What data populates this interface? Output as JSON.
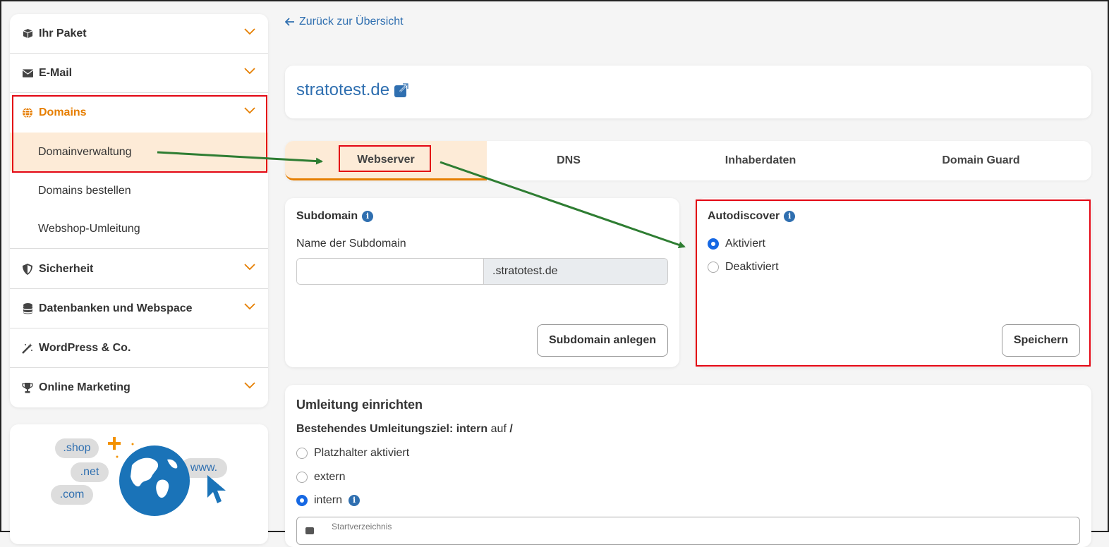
{
  "sidebar": {
    "items": [
      {
        "label": "Ihr Paket",
        "icon": "box-icon"
      },
      {
        "label": "E-Mail",
        "icon": "envelope-icon"
      },
      {
        "label": "Domains",
        "icon": "globe-icon"
      },
      {
        "label": "Sicherheit",
        "icon": "shield-icon"
      },
      {
        "label": "Datenbanken und Webspace",
        "icon": "database-icon"
      },
      {
        "label": "WordPress & Co.",
        "icon": "magic-wand-icon"
      },
      {
        "label": "Online Marketing",
        "icon": "trophy-icon"
      }
    ],
    "sub_items": [
      {
        "label": "Domainverwaltung"
      },
      {
        "label": "Domains bestellen"
      },
      {
        "label": "Webshop-Umleitung"
      }
    ],
    "accent_color": "#e67e00"
  },
  "promo": {
    "shop": ".shop",
    "net": ".net",
    "com": ".com",
    "www": "www."
  },
  "back_link": "Zurück zur Übersicht",
  "domain": "stratotest.de",
  "tabs": [
    {
      "label": "Webserver"
    },
    {
      "label": "DNS"
    },
    {
      "label": "Inhaberdaten"
    },
    {
      "label": "Domain Guard"
    }
  ],
  "subdomain": {
    "title": "Subdomain",
    "field_label": "Name der Subdomain",
    "value": "",
    "suffix": ".stratotest.de",
    "button": "Subdomain anlegen"
  },
  "autodiscover": {
    "title": "Autodiscover",
    "options": [
      {
        "label": "Aktiviert",
        "checked": true
      },
      {
        "label": "Deaktiviert",
        "checked": false
      }
    ],
    "button": "Speichern"
  },
  "redirect": {
    "title": "Umleitung einrichten",
    "current_label": "Bestehendes Umleitungsziel:",
    "current_type": "intern",
    "current_mid": "auf",
    "current_path": "/",
    "options": [
      {
        "label": "Platzhalter aktiviert",
        "checked": false
      },
      {
        "label": "extern",
        "checked": false
      },
      {
        "label": "intern",
        "checked": true
      }
    ],
    "start_dir_label": "Startverzeichnis"
  },
  "link_color": "#2f6fb0",
  "annotation_color": "#e30613",
  "arrow_color": "#2e7d32"
}
